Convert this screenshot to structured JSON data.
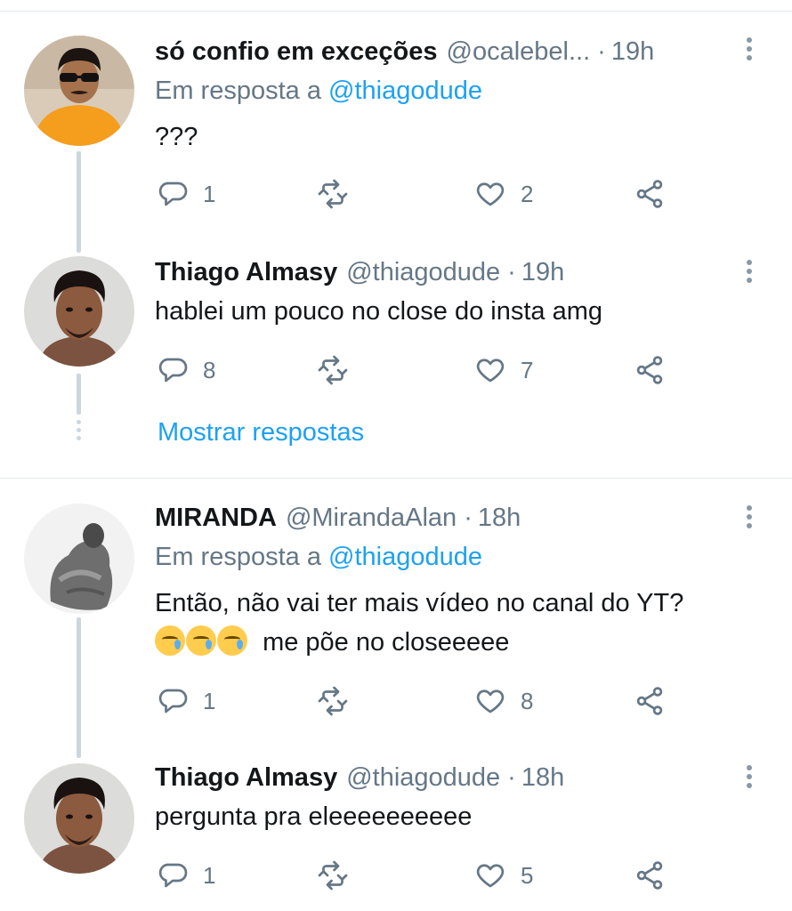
{
  "colors": {
    "accent": "#1da1f2",
    "secondary_text": "#657786",
    "thread_line": "#ccd6dd"
  },
  "tweets": [
    {
      "name": "só confio em exceções",
      "handle": "@ocalebel...",
      "separator": "·",
      "time": "19h",
      "reply_prefix": "Em resposta a",
      "reply_handle": "@thiagodude",
      "text": "???",
      "replies": "1",
      "retweets": "",
      "likes": "2"
    },
    {
      "name": "Thiago Almasy",
      "handle": "@thiagodude",
      "separator": "·",
      "time": "19h",
      "text": "hablei um pouco no close do insta amg",
      "replies": "8",
      "retweets": "",
      "likes": "7"
    },
    {
      "name": "MIRANDA",
      "handle": "@MirandaAlan",
      "separator": "·",
      "time": "18h",
      "reply_prefix": "Em resposta a",
      "reply_handle": "@thiagodude",
      "text_line1": "Então, não vai ter mais vídeo no canal do YT?",
      "text_line2": "me põe no closeeeee",
      "emoji": "crying-face",
      "replies": "1",
      "retweets": "",
      "likes": "8"
    },
    {
      "name": "Thiago Almasy",
      "handle": "@thiagodude",
      "separator": "·",
      "time": "18h",
      "text": "pergunta pra eleeeeeeeeee",
      "replies": "1",
      "retweets": "",
      "likes": "5"
    }
  ],
  "show_replies": "Mostrar respostas"
}
